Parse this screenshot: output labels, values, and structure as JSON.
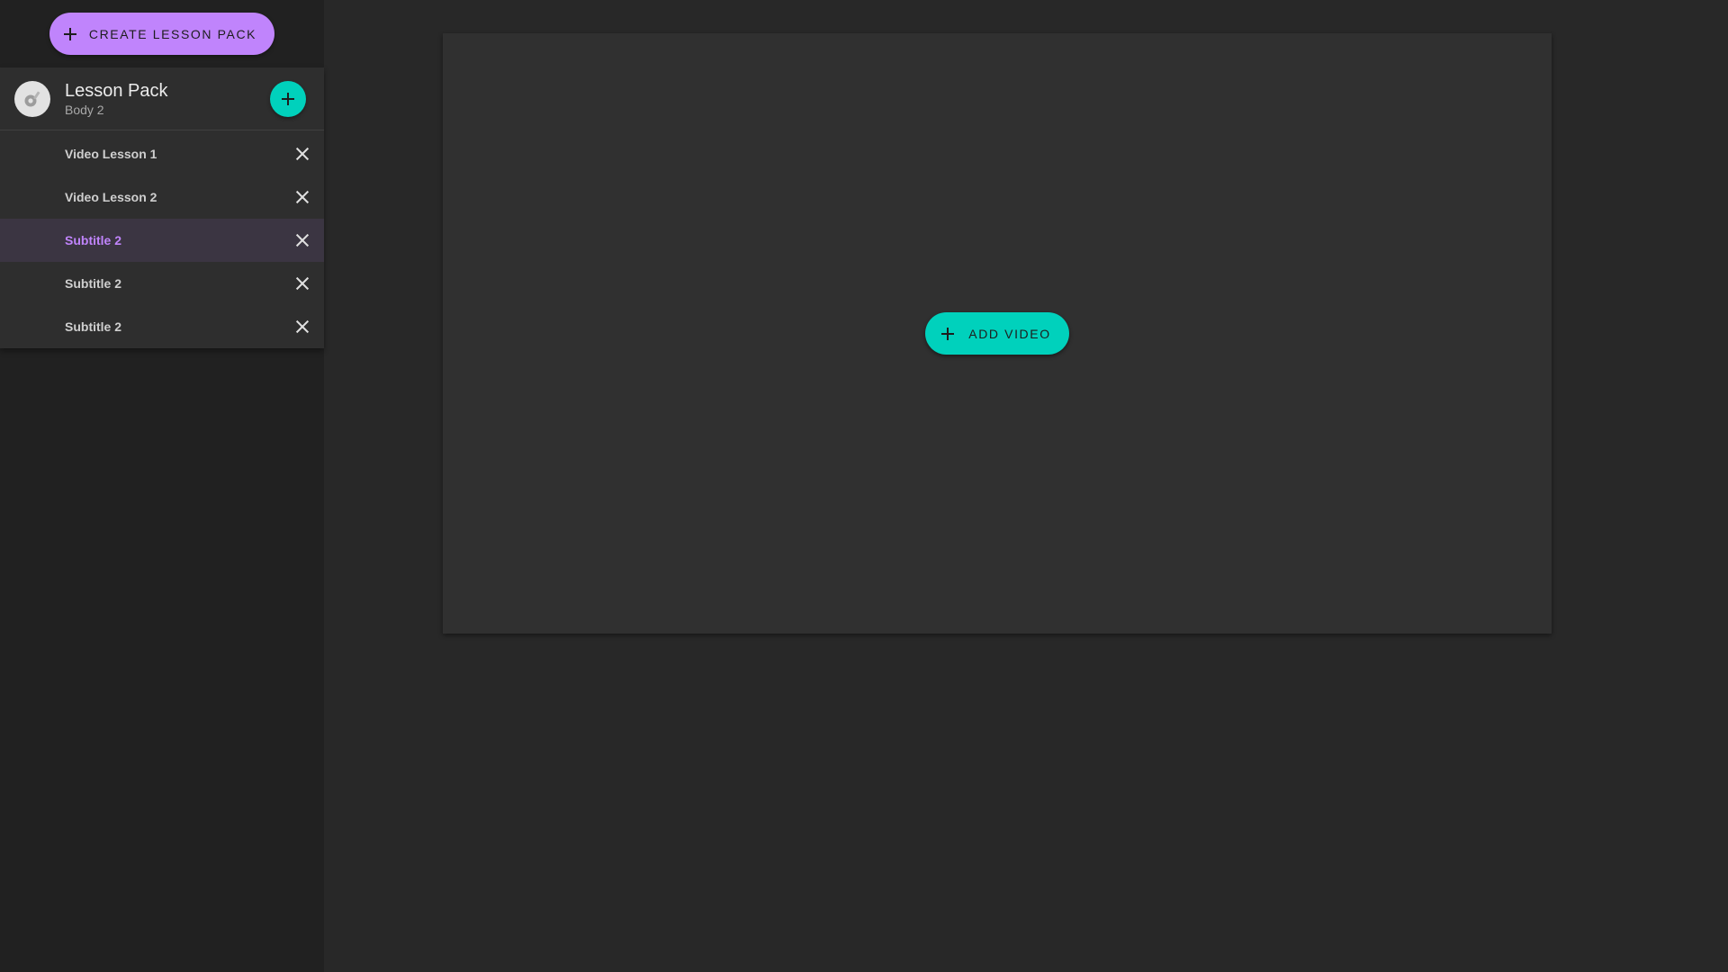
{
  "sidebar": {
    "create_button_label": "Create Lesson Pack",
    "pack": {
      "title": "Lesson Pack",
      "subtitle": "Body 2",
      "avatar_icon": "palette-icon",
      "add_icon": "plus-icon"
    },
    "lessons": [
      {
        "label": "Video Lesson 1",
        "active": false
      },
      {
        "label": "Video Lesson 2",
        "active": false
      },
      {
        "label": "Subtitle 2",
        "active": true
      },
      {
        "label": "Subtitle 2",
        "active": false
      },
      {
        "label": "Subtitle 2",
        "active": false
      }
    ]
  },
  "main": {
    "add_video_label": "Add Video"
  },
  "colors": {
    "accent_purple": "#c084fc",
    "accent_teal": "#00d1bc",
    "background": "#282828",
    "sidebar": "#212121",
    "panel": "#2e2e2e"
  }
}
